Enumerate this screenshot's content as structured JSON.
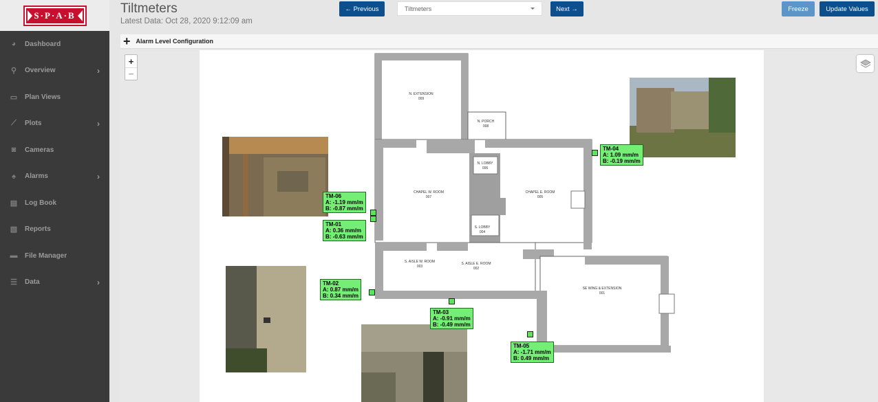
{
  "sidebar": {
    "logo_text": "S·P·A·B",
    "brand_color": "#c8102e",
    "items": [
      {
        "label": "Dashboard",
        "icon": "dashboard-icon",
        "glyph": "◕",
        "has_submenu": false
      },
      {
        "label": "Overview",
        "icon": "overview-icon",
        "glyph": "⚲",
        "has_submenu": true
      },
      {
        "label": "Plan Views",
        "icon": "plan-views-icon",
        "glyph": "▭",
        "has_submenu": false
      },
      {
        "label": "Plots",
        "icon": "plots-icon",
        "glyph": "⟋",
        "has_submenu": true
      },
      {
        "label": "Cameras",
        "icon": "camera-icon",
        "glyph": "◙",
        "has_submenu": false
      },
      {
        "label": "Alarms",
        "icon": "bell-icon",
        "glyph": "♠",
        "has_submenu": true
      },
      {
        "label": "Log Book",
        "icon": "logbook-icon",
        "glyph": "▤",
        "has_submenu": false
      },
      {
        "label": "Reports",
        "icon": "reports-icon",
        "glyph": "▧",
        "has_submenu": false
      },
      {
        "label": "File Manager",
        "icon": "folder-icon",
        "glyph": "▬",
        "has_submenu": false
      },
      {
        "label": "Data",
        "icon": "database-icon",
        "glyph": "☰",
        "has_submenu": true
      }
    ]
  },
  "header": {
    "title": "Tiltmeters",
    "latest_data": "Latest Data: Oct 28, 2020 9:12:09 am",
    "prev_label": "← Previous",
    "next_label": "Next →",
    "select_value": "Tiltmeters",
    "freeze_label": "Freeze",
    "update_label": "Update Values",
    "accent_color": "#0d4e8c",
    "light_accent_color": "#5c95c8"
  },
  "alarm_bar": {
    "label": "Alarm Level Configuration"
  },
  "map": {
    "zoom_in": "+",
    "zoom_out": "−",
    "rooms": {
      "n_extension": {
        "name": "N. EXTENSION",
        "num": "009"
      },
      "n_porch": {
        "name": "N. PORCH",
        "num": "008"
      },
      "n_lobby": {
        "name": "N. LOBBY",
        "num": "006"
      },
      "chapel_w": {
        "name": "CHAPEL W. ROOM",
        "num": "007"
      },
      "chapel_e": {
        "name": "CHAPEL E. ROOM",
        "num": "005"
      },
      "s_lobby": {
        "name": "S. LOBBY",
        "num": "004"
      },
      "s_aisle_w": {
        "name": "S. AISLE W. ROOM",
        "num": "003"
      },
      "s_aisle_e": {
        "name": "S. AISLE E. ROOM",
        "num": "002"
      },
      "se_wing": {
        "name": "SE WING & EXTENSION",
        "num": "001"
      }
    },
    "sensors": [
      {
        "id": "TM-04",
        "a": "A: 1.09 mm/m",
        "b": "B: -0.19 mm/m"
      },
      {
        "id": "TM-06",
        "a": "A: -1.19 mm/m",
        "b": "B: -0.87 mm/m"
      },
      {
        "id": "TM-01",
        "a": "A: 0.36 mm/m",
        "b": "B: -0.63 mm/m"
      },
      {
        "id": "TM-02",
        "a": "A: 0.87 mm/m",
        "b": "B: 0.34 mm/m"
      },
      {
        "id": "TM-03",
        "a": "A: -0.91 mm/m",
        "b": "B: -0.49 mm/m"
      },
      {
        "id": "TM-05",
        "a": "A: -1.71 mm/m",
        "b": "B: 0.49 mm/m"
      }
    ],
    "sensor_color": "#74ee74"
  }
}
